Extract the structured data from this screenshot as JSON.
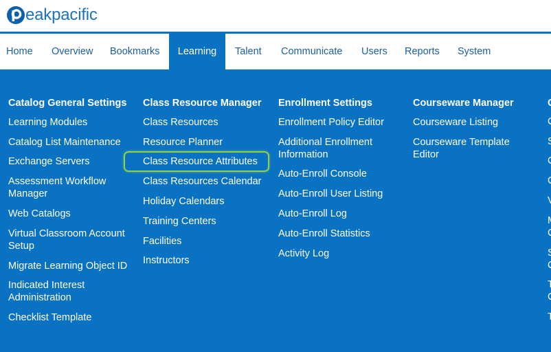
{
  "brand": {
    "name": "peakpacific",
    "logo_icon": "peakpacific-p-logo-icon",
    "text_after_mark": "eakpacific"
  },
  "colors": {
    "brand_blue": "#0a72c2",
    "nav_text": "#1a5e9e",
    "highlight": "#8fd14a"
  },
  "nav": {
    "items": [
      {
        "label": "Home"
      },
      {
        "label": "Overview"
      },
      {
        "label": "Bookmarks"
      },
      {
        "label": "Learning",
        "active": true
      },
      {
        "label": "Talent"
      },
      {
        "label": "Communicate"
      },
      {
        "label": "Users"
      },
      {
        "label": "Reports"
      },
      {
        "label": "System"
      }
    ]
  },
  "menu": {
    "columns": [
      {
        "heading": "Catalog General Settings",
        "links": [
          "Learning Modules",
          "Catalog List Maintenance",
          "Exchange Servers",
          "Assessment Workflow Manager",
          "Web Catalogs",
          "Virtual Classroom Account Setup",
          "Migrate Learning Object ID",
          "Indicated Interest Administration",
          "Checklist Template"
        ]
      },
      {
        "heading": "Class Resource Manager",
        "links": [
          "Class Resources",
          "Resource Planner",
          "Class Resource Attributes",
          "Class Resources Calendar",
          "Holiday Calendars",
          "Training Centers",
          "Facilities",
          "Instructors"
        ]
      },
      {
        "heading": "Enrollment Settings",
        "links": [
          "Enrollment Policy Editor",
          "Additional Enrollment Information",
          "Auto-Enroll Console",
          "Auto-Enroll User Listing",
          "Auto-Enroll Log",
          "Auto-Enroll Statistics",
          "Activity Log"
        ]
      },
      {
        "heading": "Courseware Manager",
        "links": [
          "Courseware Listing",
          "Courseware Template Editor"
        ]
      }
    ],
    "highlighted_link": "Class Resource Attributes",
    "cut_off_column": {
      "heading": "C",
      "fragments": [
        "C",
        "S",
        "C",
        "C",
        "V",
        "M",
        "C",
        "S",
        "C",
        "T",
        "C",
        "T"
      ]
    }
  }
}
